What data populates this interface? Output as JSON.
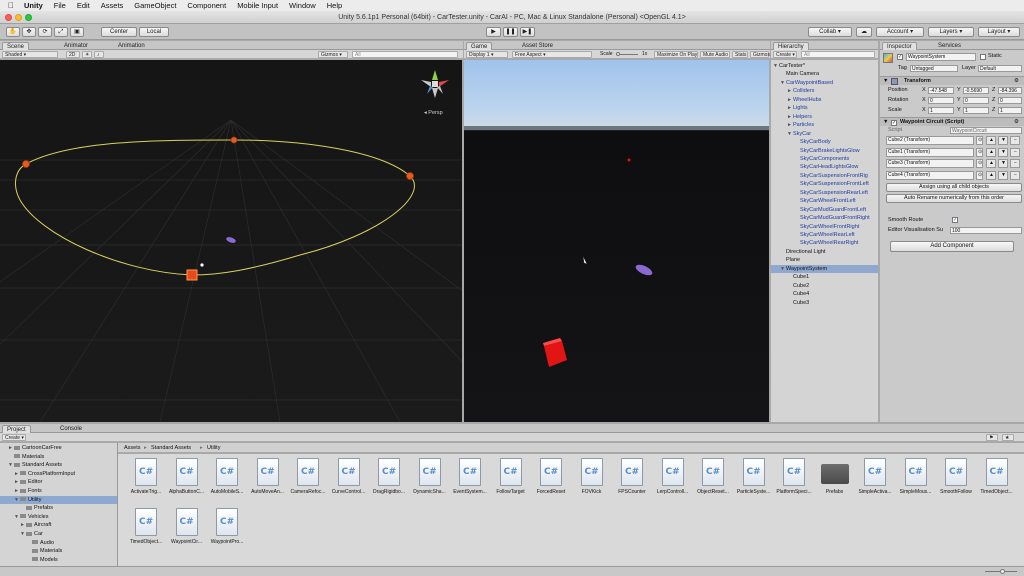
{
  "menubar": {
    "app": "Unity",
    "items": [
      "File",
      "Edit",
      "Assets",
      "GameObject",
      "Component",
      "Mobile Input",
      "Window",
      "Help"
    ]
  },
  "window_title": "Unity 5.6.1p1 Personal (64bit) - CarTester.unity - CarAI - PC, Mac & Linux Standalone (Personal) <OpenGL 4.1>",
  "toolbar": {
    "pivot": "Center",
    "space": "Local",
    "collab": "Collab",
    "account": "Account",
    "layers": "Layers",
    "layout": "Layout"
  },
  "scene": {
    "tabs": [
      "Scene",
      "Animator",
      "Animation"
    ],
    "shading": "Shaded",
    "mode_2d": "2D",
    "gizmos": "Gizmos",
    "search_placeholder": "All",
    "persp": "Persp"
  },
  "game": {
    "tabs": [
      "Game",
      "Asset Store"
    ],
    "display": "Display 1",
    "aspect": "Free Aspect",
    "scale_label": "Scale",
    "scale_value": "1x",
    "options": [
      "Maximize On Play",
      "Mute Audio",
      "Stats",
      "Gizmos"
    ]
  },
  "hierarchy": {
    "tab": "Hierarchy",
    "create": "Create",
    "search_placeholder": "All",
    "items": [
      {
        "label": "CarTester*",
        "indent": 0,
        "arrow": "▼",
        "blue": false
      },
      {
        "label": "Main Camera",
        "indent": 1,
        "arrow": "",
        "blue": false
      },
      {
        "label": "CarWaypointBased",
        "indent": 1,
        "arrow": "▼",
        "blue": true
      },
      {
        "label": "Colliders",
        "indent": 2,
        "arrow": "►",
        "blue": true
      },
      {
        "label": "WheelHubs",
        "indent": 2,
        "arrow": "►",
        "blue": true
      },
      {
        "label": "Lights",
        "indent": 2,
        "arrow": "►",
        "blue": true
      },
      {
        "label": "Helpers",
        "indent": 2,
        "arrow": "►",
        "blue": true
      },
      {
        "label": "Particles",
        "indent": 2,
        "arrow": "►",
        "blue": true
      },
      {
        "label": "SkyCar",
        "indent": 2,
        "arrow": "▼",
        "blue": true
      },
      {
        "label": "SkyCarBody",
        "indent": 3,
        "arrow": "",
        "blue": true
      },
      {
        "label": "SkyCarBrakeLightsGlow",
        "indent": 3,
        "arrow": "",
        "blue": true
      },
      {
        "label": "SkyCarComponents",
        "indent": 3,
        "arrow": "",
        "blue": true
      },
      {
        "label": "SkyCarHeadLightsGlow",
        "indent": 3,
        "arrow": "",
        "blue": true
      },
      {
        "label": "SkyCarSuspensionFrontRig",
        "indent": 3,
        "arrow": "",
        "blue": true
      },
      {
        "label": "SkyCarSuspensionFrontLeft",
        "indent": 3,
        "arrow": "",
        "blue": true
      },
      {
        "label": "SkyCarSuspensionRearLeft",
        "indent": 3,
        "arrow": "",
        "blue": true
      },
      {
        "label": "SkyCarWheelFrontLeft",
        "indent": 3,
        "arrow": "",
        "blue": true
      },
      {
        "label": "SkyCarMudGuardFrontLeft",
        "indent": 3,
        "arrow": "",
        "blue": true
      },
      {
        "label": "SkyCarMudGuardFrontRight",
        "indent": 3,
        "arrow": "",
        "blue": true
      },
      {
        "label": "SkyCarWheelFrontRight",
        "indent": 3,
        "arrow": "",
        "blue": true
      },
      {
        "label": "SkyCarWheelRearLeft",
        "indent": 3,
        "arrow": "",
        "blue": true
      },
      {
        "label": "SkyCarWheelRearRight",
        "indent": 3,
        "arrow": "",
        "blue": true
      },
      {
        "label": "Directional Light",
        "indent": 1,
        "arrow": "",
        "blue": false
      },
      {
        "label": "Plane",
        "indent": 1,
        "arrow": "",
        "blue": false
      },
      {
        "label": "WaypointSystem",
        "indent": 1,
        "arrow": "▼",
        "blue": false,
        "selected": true
      },
      {
        "label": "Cube1",
        "indent": 2,
        "arrow": "",
        "blue": false
      },
      {
        "label": "Cube2",
        "indent": 2,
        "arrow": "",
        "blue": false
      },
      {
        "label": "Cube4",
        "indent": 2,
        "arrow": "",
        "blue": false
      },
      {
        "label": "Cube3",
        "indent": 2,
        "arrow": "",
        "blue": false
      }
    ]
  },
  "inspector": {
    "tabs": [
      "Inspector",
      "Services"
    ],
    "object_name": "WaypointSystem",
    "static_label": "Static",
    "tag_label": "Tag",
    "tag_value": "Untagged",
    "layer_label": "Layer",
    "layer_value": "Default",
    "transform": {
      "title": "Transform",
      "position_label": "Position",
      "rotation_label": "Rotation",
      "scale_label": "Scale",
      "position": {
        "x": "-47.548",
        "y": "-0.5690",
        "z": "-84.396"
      },
      "rotation": {
        "x": "0",
        "y": "0",
        "z": "0"
      },
      "scale": {
        "x": "1",
        "y": "1",
        "z": "1"
      }
    },
    "waypoint_circuit": {
      "title": "Waypoint Circuit (Script)",
      "script_label": "Script",
      "script_value": "WaypointCircuit",
      "items": [
        "Cube2 (Transform)",
        "Cube1 (Transform)",
        "Cube3 (Transform)",
        "Cube4 (Transform)"
      ],
      "assign_button": "Assign using all child objects",
      "rename_button": "Auto Rename numerically from this order",
      "smooth_route_label": "Smooth Route",
      "smooth_route": true,
      "editor_vis_label": "Editor Visualisation Su",
      "editor_vis_value": "100"
    },
    "add_component": "Add Component"
  },
  "project": {
    "tabs": [
      "Project",
      "Console"
    ],
    "create": "Create",
    "breadcrumb": [
      "Assets",
      "Standard Assets",
      "Utility"
    ],
    "tree": [
      {
        "label": "CartoonCarFree",
        "indent": 1,
        "arrow": "►"
      },
      {
        "label": "Materials",
        "indent": 1,
        "arrow": ""
      },
      {
        "label": "Standard Assets",
        "indent": 1,
        "arrow": "▼"
      },
      {
        "label": "CrossPlatformInput",
        "indent": 2,
        "arrow": "►"
      },
      {
        "label": "Editor",
        "indent": 2,
        "arrow": "►"
      },
      {
        "label": "Fonts",
        "indent": 2,
        "arrow": "►"
      },
      {
        "label": "Utility",
        "indent": 2,
        "arrow": "▼",
        "selected": true
      },
      {
        "label": "Prefabs",
        "indent": 3,
        "arrow": ""
      },
      {
        "label": "Vehicles",
        "indent": 2,
        "arrow": "▼"
      },
      {
        "label": "Aircraft",
        "indent": 3,
        "arrow": "►"
      },
      {
        "label": "Car",
        "indent": 3,
        "arrow": "▼"
      },
      {
        "label": "Audio",
        "indent": 4,
        "arrow": ""
      },
      {
        "label": "Materials",
        "indent": 4,
        "arrow": ""
      },
      {
        "label": "Models",
        "indent": 4,
        "arrow": ""
      }
    ],
    "assets": [
      {
        "label": "ActivateTrig...",
        "kind": "cs"
      },
      {
        "label": "AlphaButtonC...",
        "kind": "cs"
      },
      {
        "label": "AutoMobileS...",
        "kind": "cs"
      },
      {
        "label": "AutoMoveAn...",
        "kind": "cs"
      },
      {
        "label": "CameraRefoc...",
        "kind": "cs"
      },
      {
        "label": "CurveControl...",
        "kind": "cs"
      },
      {
        "label": "DragRigidbo...",
        "kind": "cs"
      },
      {
        "label": "DynamicSha...",
        "kind": "cs"
      },
      {
        "label": "EventSystem...",
        "kind": "cs"
      },
      {
        "label": "FollowTarget",
        "kind": "cs"
      },
      {
        "label": "ForcedReset",
        "kind": "cs"
      },
      {
        "label": "FOVKick",
        "kind": "cs"
      },
      {
        "label": "FPSCounter",
        "kind": "cs"
      },
      {
        "label": "LerpControll...",
        "kind": "cs"
      },
      {
        "label": "ObjectReset...",
        "kind": "cs"
      },
      {
        "label": "ParticleSyste...",
        "kind": "cs"
      },
      {
        "label": "PlatformSpeci...",
        "kind": "cs"
      },
      {
        "label": "Prefabs",
        "kind": "folder"
      },
      {
        "label": "SimpleActiva...",
        "kind": "cs"
      },
      {
        "label": "SimpleMous...",
        "kind": "cs"
      },
      {
        "label": "SmoothFollow",
        "kind": "cs"
      },
      {
        "label": "TimedObject...",
        "kind": "cs"
      },
      {
        "label": "TimedObject...",
        "kind": "cs"
      },
      {
        "label": "WaypointCir...",
        "kind": "cs"
      },
      {
        "label": "WaypointPro...",
        "kind": "cs"
      }
    ]
  },
  "colors": {
    "scene_bg": "#141414",
    "waypoint_line": "#d8d060",
    "waypoint_node": "#e85a1e",
    "sky_top": "#9fc3ec",
    "cube_red": "#e21414",
    "car_purple": "#8a6ad0",
    "hierarchy_link": "#1f3ca0",
    "selection": "#8fa8cf"
  },
  "icons": [
    "apple-icon",
    "hand-tool-icon",
    "move-tool-icon",
    "rotate-tool-icon",
    "scale-tool-icon",
    "rect-tool-icon",
    "play-icon",
    "pause-icon",
    "step-icon",
    "cloud-icon",
    "scene-gizmo-icon",
    "csharp-script-icon",
    "folder-icon",
    "lock-icon"
  ]
}
